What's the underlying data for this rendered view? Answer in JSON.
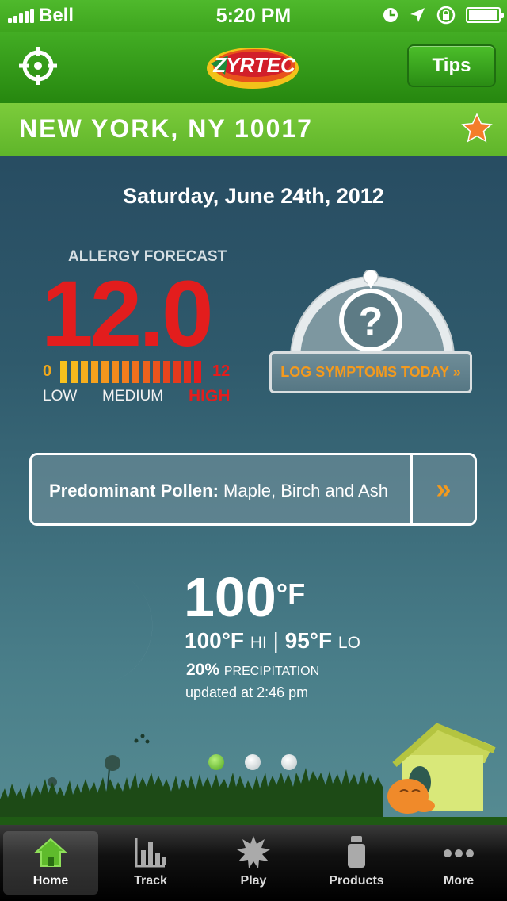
{
  "status_bar": {
    "carrier": "Bell",
    "time": "5:20 PM"
  },
  "header": {
    "logo_text": "ZYRTEC",
    "tips_label": "Tips"
  },
  "location": {
    "city": "NEW YORK, NY 10017"
  },
  "date": "Saturday, June 24th, 2012",
  "forecast": {
    "label": "ALLERGY FORECAST",
    "value": "12.0",
    "scale_min": "0",
    "scale_max": "12",
    "level_low": "LOW",
    "level_medium": "MEDIUM",
    "level_high": "HIGH",
    "level_fraction": 1.0
  },
  "log_symptoms": {
    "label": "LOG SYMPTOMS TODAY »",
    "icon_glyph": "?"
  },
  "pollen": {
    "label": "Predominant Pollen:",
    "value": "Maple, Birch and Ash",
    "arrow": "»"
  },
  "weather": {
    "temp": "100",
    "unit": "°F",
    "hi": "100°F",
    "hi_label": "HI",
    "lo": "95°F",
    "lo_label": "LO",
    "precip_value": "20%",
    "precip_label": "PRECIPITATION",
    "updated": "updated at 2:46 pm"
  },
  "pager": {
    "count": 3,
    "active": 0
  },
  "tabs": [
    {
      "label": "Home",
      "icon": "home-icon"
    },
    {
      "label": "Track",
      "icon": "bar-chart-icon"
    },
    {
      "label": "Play",
      "icon": "splat-icon"
    },
    {
      "label": "Products",
      "icon": "bottle-icon"
    },
    {
      "label": "More",
      "icon": "more-dots-icon"
    }
  ],
  "colors": {
    "brand_green": "#3ea51e",
    "accent_orange": "#f39a1e",
    "high_red": "#e31d1d"
  }
}
